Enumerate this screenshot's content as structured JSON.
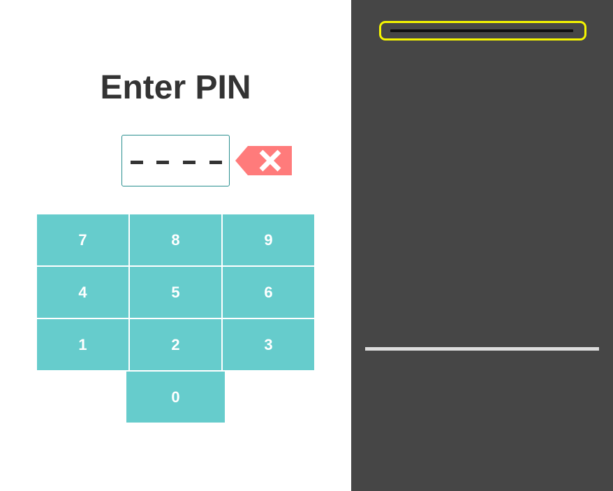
{
  "title": "Enter PIN",
  "pin": {
    "slots": 4,
    "filled": 0,
    "border_color": "#2a8f8f"
  },
  "backspace": {
    "icon": "backspace-x-icon",
    "color": "#ff7b7b"
  },
  "keypad": {
    "color": "#66cccc",
    "keys": [
      "7",
      "8",
      "9",
      "4",
      "5",
      "6",
      "1",
      "2",
      "3",
      "0"
    ]
  },
  "right_panel": {
    "background": "#464646",
    "highlight_color": "#f5f500"
  }
}
